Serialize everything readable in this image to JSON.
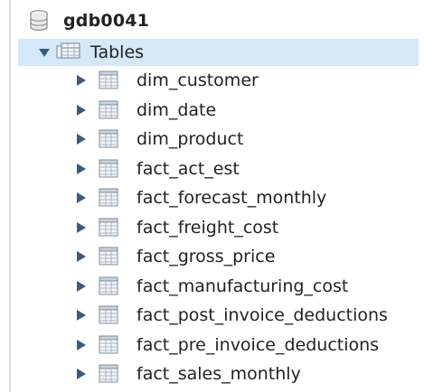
{
  "schema": {
    "name": "gdb0041",
    "icon": "database-icon"
  },
  "tables_node": {
    "label": "Tables",
    "expanded": true,
    "icon": "tables-folder-icon",
    "arrow_icon": "expanded-arrow-icon"
  },
  "tables": [
    {
      "name": "dim_customer"
    },
    {
      "name": "dim_date"
    },
    {
      "name": "dim_product"
    },
    {
      "name": "fact_act_est"
    },
    {
      "name": "fact_forecast_monthly"
    },
    {
      "name": "fact_freight_cost"
    },
    {
      "name": "fact_gross_price"
    },
    {
      "name": "fact_manufacturing_cost"
    },
    {
      "name": "fact_post_invoice_deductions"
    },
    {
      "name": "fact_pre_invoice_deductions"
    },
    {
      "name": "fact_sales_monthly"
    }
  ],
  "colors": {
    "selection": "#d3e8f8",
    "arrow": "#3c5a7a",
    "text": "#222222"
  }
}
